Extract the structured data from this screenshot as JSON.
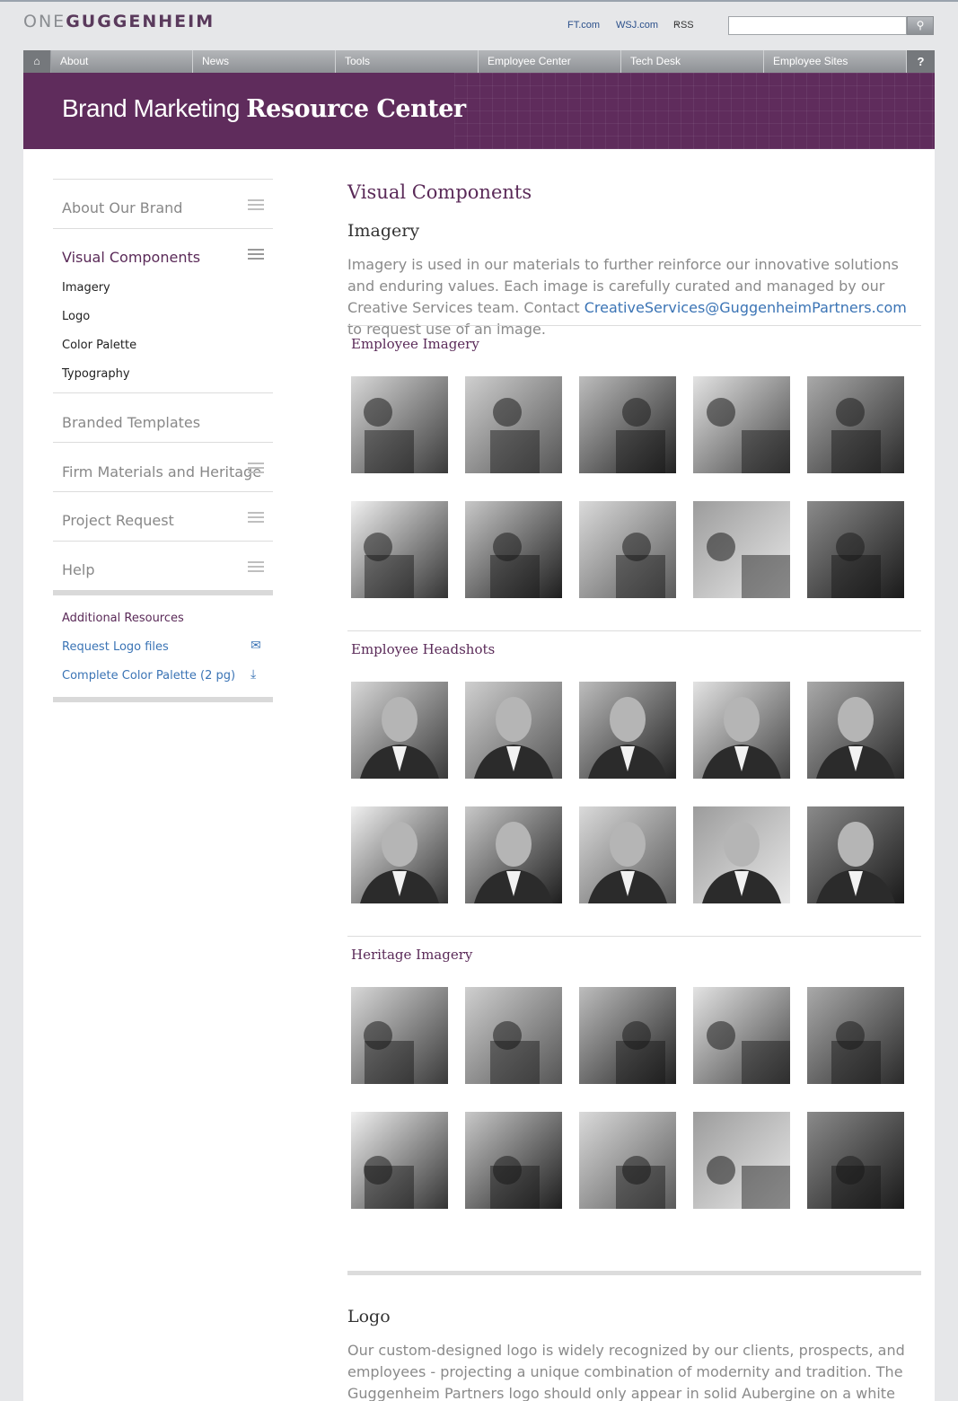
{
  "header": {
    "logo_one": "ONE",
    "logo_gug": "GUGGENHEIM",
    "links": [
      "FT.com",
      "WSJ.com",
      "RSS"
    ],
    "search_placeholder": ""
  },
  "nav": {
    "items": [
      "About",
      "News",
      "Tools",
      "Employee Center",
      "Tech Desk",
      "Employee Sites"
    ],
    "help": "?"
  },
  "banner": {
    "title_light": "Brand Marketing ",
    "title_bold": "Resource Center"
  },
  "sidebar": {
    "items": [
      {
        "label": "About Our Brand"
      },
      {
        "label": "Visual Components"
      },
      {
        "label": "Branded Templates"
      },
      {
        "label": "Firm Materials and Heritage"
      },
      {
        "label": "Project Request"
      },
      {
        "label": "Help"
      }
    ],
    "sub_items": [
      "Imagery",
      "Logo",
      "Color Palette",
      "Typography"
    ],
    "resources_title": "Additional Resources",
    "resources": [
      {
        "label": "Request Logo files",
        "icon": "envelope-icon"
      },
      {
        "label": "Complete Color Palette (2 pg)",
        "icon": "download-icon"
      }
    ]
  },
  "content": {
    "title": "Visual Components",
    "imagery_heading": "Imagery",
    "imagery_text_before": "Imagery is used in our materials to further reinforce our innovative solutions and enduring values. Each image is carefully curated and managed by our Creative Services team. Contact ",
    "imagery_email": "CreativeServices@GuggenheimPartners.com",
    "imagery_text_after": " to request use of an image.",
    "sections": [
      "Employee Imagery",
      "Employee Headshots",
      "Heritage Imagery"
    ],
    "logo_heading": "Logo",
    "logo_text": "Our custom-designed logo is widely recognized by our clients, prospects, and employees - projecting a unique combination of modernity and tradition. The Guggenheim Partners logo should only appear in solid Aubergine  on a white background or reversed out of"
  },
  "colors": {
    "aubergine": "#5f2c5c",
    "link_blue": "#3b74b5",
    "nav_gray": "#8e9195"
  }
}
